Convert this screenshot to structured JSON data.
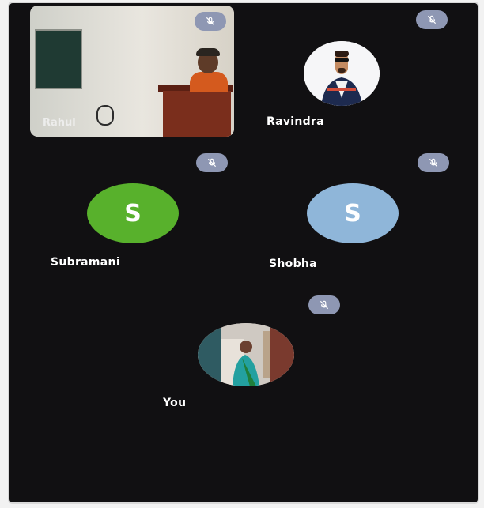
{
  "participants": [
    {
      "name": "Rahul",
      "muted": true
    },
    {
      "name": "Ravindra",
      "muted": true
    },
    {
      "name": "Subramani",
      "initial": "S",
      "muted": true
    },
    {
      "name": "Shobha",
      "initial": "S",
      "muted": true
    },
    {
      "name": "You",
      "muted": true
    }
  ],
  "colors": {
    "background": "#111012",
    "mic_badge": "#8e97b3",
    "subramani_avatar": "#58b12c",
    "shobha_avatar": "#8fb6d9"
  },
  "icons": {
    "mic_badge": "mic-off-icon"
  }
}
